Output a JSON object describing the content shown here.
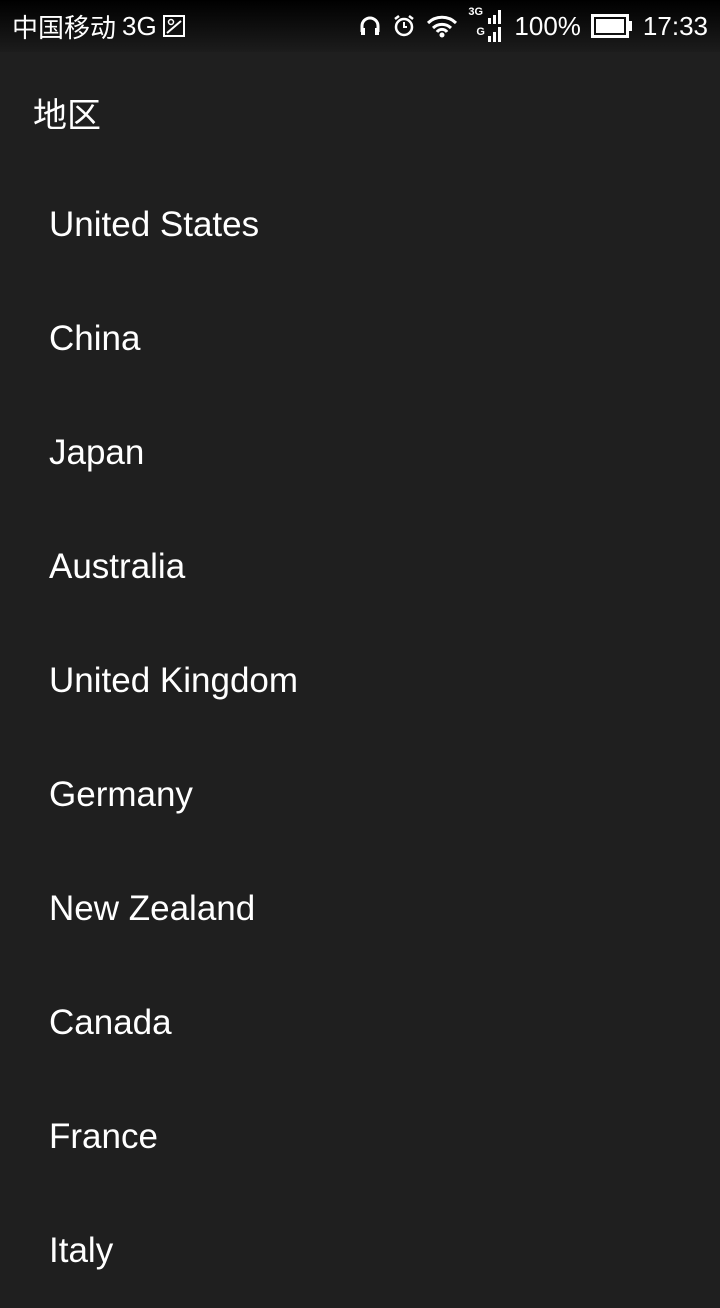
{
  "status_bar": {
    "carrier": "中国移动",
    "network": "3G",
    "battery": "100%",
    "time": "17:33",
    "signal_labels": [
      "3G",
      "G"
    ]
  },
  "header": {
    "title": "地区"
  },
  "regions": [
    "United States",
    "China",
    "Japan",
    "Australia",
    "United Kingdom",
    "Germany",
    "New Zealand",
    "Canada",
    "France",
    "Italy"
  ]
}
